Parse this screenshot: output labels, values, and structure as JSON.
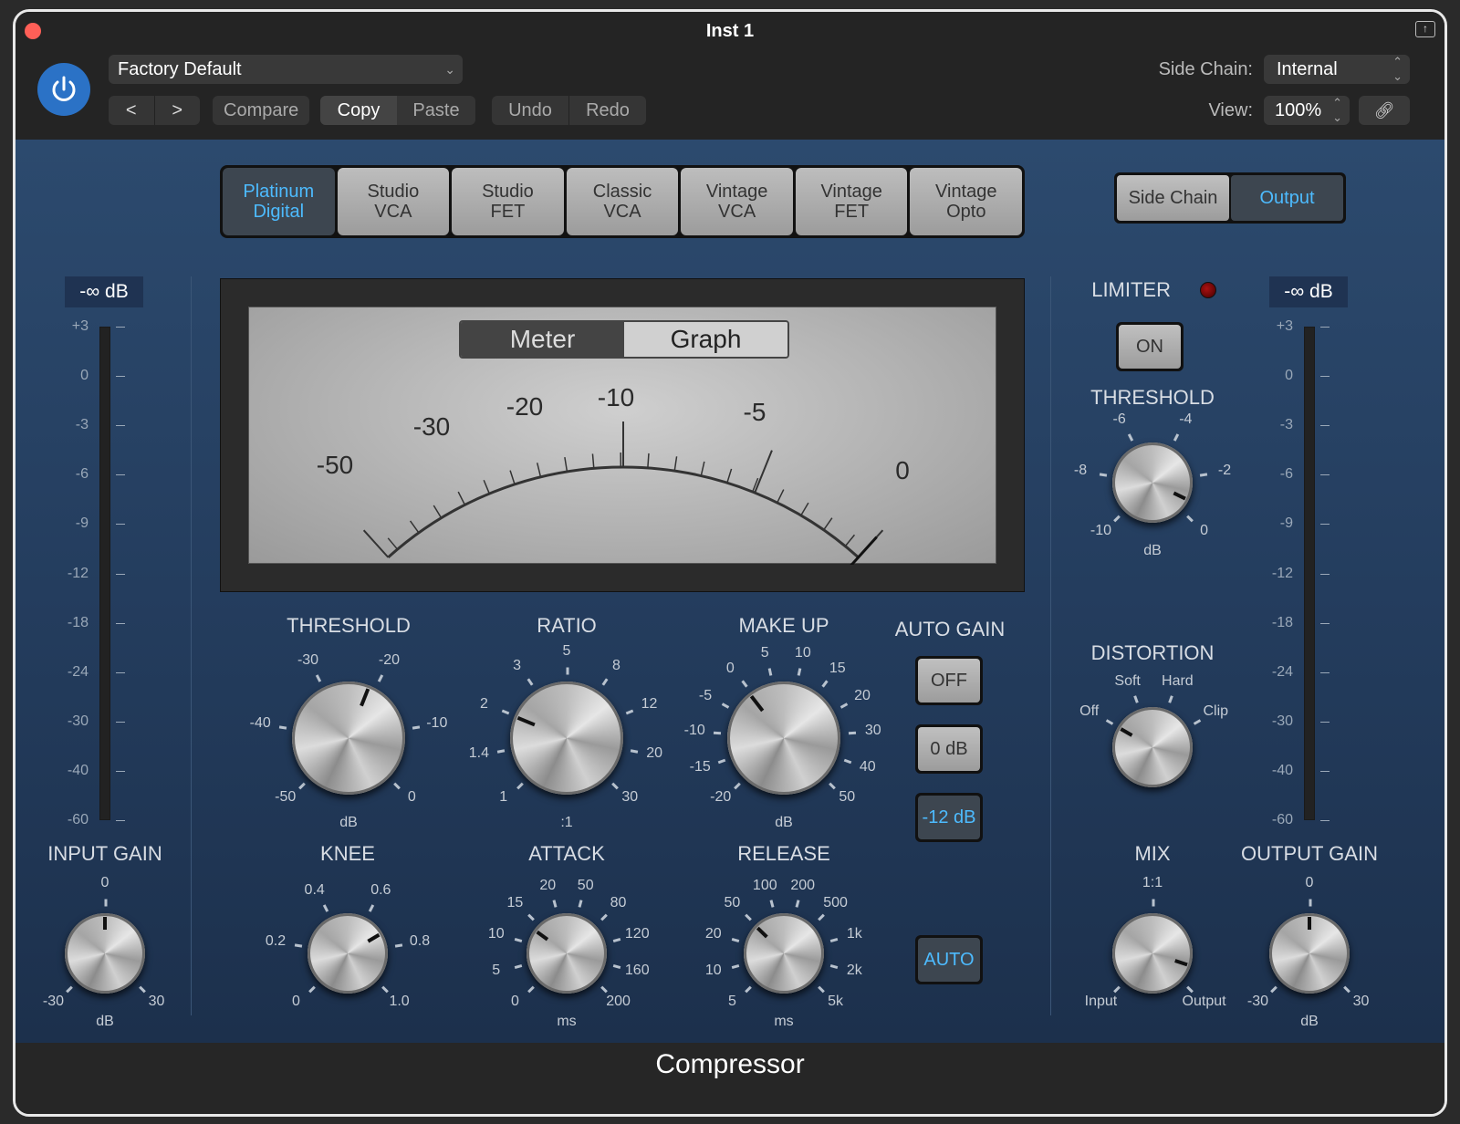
{
  "window": {
    "title": "Inst 1",
    "footer_title": "Compressor"
  },
  "header": {
    "preset": "Factory Default",
    "nav": {
      "prev": "<",
      "next": ">"
    },
    "compare": "Compare",
    "copy": "Copy",
    "paste": "Paste",
    "undo": "Undo",
    "redo": "Redo",
    "side_chain_label": "Side Chain:",
    "side_chain_value": "Internal",
    "view_label": "View:",
    "view_value": "100%"
  },
  "circuit_types": [
    {
      "label": "Platinum\nDigital",
      "selected": true
    },
    {
      "label": "Studio\nVCA",
      "selected": false
    },
    {
      "label": "Studio\nFET",
      "selected": false
    },
    {
      "label": "Classic\nVCA",
      "selected": false
    },
    {
      "label": "Vintage\nVCA",
      "selected": false
    },
    {
      "label": "Vintage\nFET",
      "selected": false
    },
    {
      "label": "Vintage\nOpto",
      "selected": false
    }
  ],
  "view_tabs": [
    {
      "label": "Side Chain",
      "selected": false
    },
    {
      "label": "Output",
      "selected": true
    }
  ],
  "input_meter": {
    "readout": "-∞ dB"
  },
  "output_meter": {
    "readout": "-∞ dB"
  },
  "meter_scale": [
    "+3",
    "0",
    "-3",
    "-6",
    "-9",
    "-12",
    "-18",
    "-24",
    "-30",
    "-40",
    "-60"
  ],
  "vu": {
    "toggle": [
      {
        "label": "Meter",
        "selected": true
      },
      {
        "label": "Graph",
        "selected": false
      }
    ],
    "scale": [
      "-50",
      "-30",
      "-20",
      "-10",
      "-5",
      "0"
    ],
    "needle_value_db": 0
  },
  "limiter": {
    "label": "LIMITER",
    "on_label": "ON",
    "threshold_label": "THRESHOLD"
  },
  "auto_gain": {
    "label": "AUTO GAIN",
    "options": [
      {
        "label": "OFF",
        "selected": false
      },
      {
        "label": "0 dB",
        "selected": false
      },
      {
        "label": "-12 dB",
        "selected": true
      }
    ],
    "auto_label": "AUTO",
    "auto_selected": true
  },
  "knobs": {
    "threshold": {
      "label": "THRESHOLD",
      "unit": "dB",
      "scale": [
        "-50",
        "-40",
        "-30",
        "-20",
        "-10",
        "0"
      ],
      "position": 0.58
    },
    "ratio": {
      "label": "RATIO",
      "unit": ":1",
      "scale": [
        "1",
        "1.4",
        "2",
        "3",
        "5",
        "8",
        "12",
        "20",
        "30"
      ],
      "position": 0.25
    },
    "makeup": {
      "label": "MAKE UP",
      "unit": "dB",
      "scale": [
        "-20",
        "-15",
        "-10",
        "-5",
        "0",
        "5",
        "10",
        "15",
        "20",
        "30",
        "40",
        "50"
      ],
      "position": 0.36
    },
    "knee": {
      "label": "KNEE",
      "scale": [
        "0",
        "0.2",
        "0.4",
        "0.6",
        "0.8",
        "1.0"
      ],
      "position": 0.72
    },
    "attack": {
      "label": "ATTACK",
      "unit": "ms",
      "scale": [
        "0",
        "5",
        "10",
        "15",
        "20",
        "50",
        "80",
        "120",
        "160",
        "200"
      ],
      "position": 0.3
    },
    "release": {
      "label": "RELEASE",
      "unit": "ms",
      "scale": [
        "5",
        "10",
        "20",
        "50",
        "100",
        "200",
        "500",
        "1k",
        "2k",
        "5k"
      ],
      "position": 0.33
    },
    "input_gain": {
      "label": "INPUT GAIN",
      "unit": "dB",
      "scale": [
        "-30",
        "0",
        "30"
      ],
      "position": 0.5
    },
    "output_gain": {
      "label": "OUTPUT GAIN",
      "unit": "dB",
      "scale": [
        "-30",
        "0",
        "30"
      ],
      "position": 0.5
    },
    "limiter_threshold": {
      "label": "THRESHOLD",
      "unit": "dB",
      "scale": [
        "-10",
        "-8",
        "-6",
        "-4",
        "-2",
        "0"
      ],
      "position": 0.93
    },
    "distortion": {
      "label": "DISTORTION",
      "scale": [
        "Off",
        "Soft",
        "Hard",
        "Clip"
      ],
      "position": 0.0
    },
    "mix": {
      "label": "MIX",
      "scale": [
        "Input",
        "1:1",
        "Output"
      ],
      "position": 0.9
    }
  }
}
